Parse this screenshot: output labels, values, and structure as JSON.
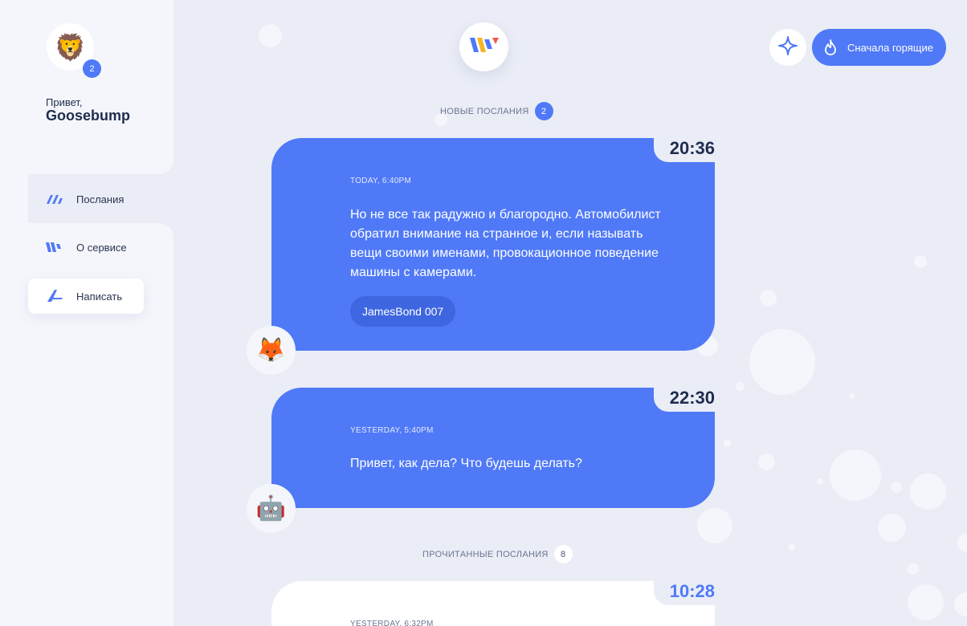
{
  "sidebar": {
    "avatar_emoji": "🦁",
    "avatar_badge": "2",
    "greeting": "Привет,",
    "username": "Goosebump",
    "nav": [
      {
        "label": "Послания",
        "icon": "messages-icon"
      },
      {
        "label": "О сервисе",
        "icon": "service-logo-icon"
      },
      {
        "label": "Написать",
        "icon": "write-icon"
      }
    ]
  },
  "header": {
    "logo": "w-logo-icon",
    "sparkle_icon": "sparkle-icon",
    "sort_button": "Сначала горящие",
    "sort_icon": "fire-icon"
  },
  "sections": {
    "new_label": "НОВЫЕ ПОСЛАНИЯ",
    "new_count": "2",
    "read_label": "ПРОЧИТАННЫЕ ПОСЛАНИЯ",
    "read_count": "8"
  },
  "messages": [
    {
      "time": "20:36",
      "date": "TODAY, 6:40PM",
      "text": "Но не все так радужно и благородно. Автомобилист обратил внимание на странное и, если называть вещи своими именами, провокационное поведение машины с камерами.",
      "tag": "JamesBond 007",
      "avatar_emoji": "🦊"
    },
    {
      "time": "22:30",
      "date": "YESTERDAY, 5:40PM",
      "text": "Привет, как дела? Что будешь делать?",
      "avatar_emoji": "🤖"
    },
    {
      "time": "10:28",
      "date": "YESTERDAY, 6:32PM"
    }
  ],
  "colors": {
    "accent": "#4f79f7",
    "background": "#eaedf6",
    "panel": "#f4f6fb",
    "text_dark": "#1f2d4e"
  }
}
